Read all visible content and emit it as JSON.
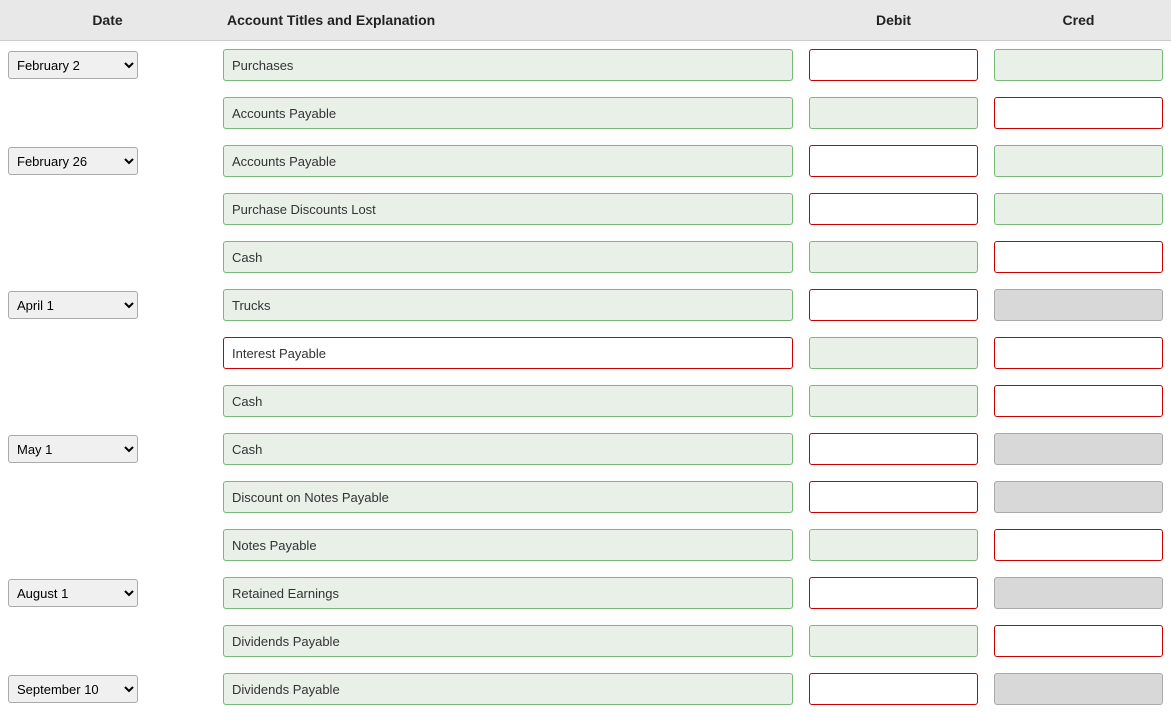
{
  "header": {
    "date_label": "Date",
    "account_label": "Account Titles and Explanation",
    "debit_label": "Debit",
    "credit_label": "Cred"
  },
  "rows": [
    {
      "date": "February 2",
      "date_options": [
        "February 2",
        "February 26",
        "April 1",
        "May 1",
        "August 1",
        "September 10"
      ],
      "account": "Purchases",
      "account_red_border": false,
      "debit_red": true,
      "credit_gray": false,
      "credit_red": false
    },
    {
      "date": "",
      "account": "Accounts Payable",
      "account_red_border": false,
      "debit_red": false,
      "credit_gray": false,
      "credit_red": true
    },
    {
      "date": "February 26",
      "date_options": [
        "February 2",
        "February 26",
        "April 1",
        "May 1",
        "August 1",
        "September 10"
      ],
      "account": "Accounts Payable",
      "account_red_border": false,
      "debit_red": true,
      "credit_gray": false,
      "credit_red": false
    },
    {
      "date": "",
      "account": "Purchase Discounts Lost",
      "account_red_border": false,
      "debit_red": true,
      "credit_gray": false,
      "credit_red": false
    },
    {
      "date": "",
      "account": "Cash",
      "account_red_border": false,
      "debit_red": false,
      "credit_gray": false,
      "credit_red": true
    },
    {
      "date": "April 1",
      "date_options": [
        "February 2",
        "February 26",
        "April 1",
        "May 1",
        "August 1",
        "September 10"
      ],
      "account": "Trucks",
      "account_red_border": false,
      "debit_red": true,
      "credit_gray": true,
      "credit_red": false
    },
    {
      "date": "",
      "account": "Interest Payable",
      "account_red_border": true,
      "debit_red": false,
      "credit_gray": false,
      "credit_red": true
    },
    {
      "date": "",
      "account": "Cash",
      "account_red_border": false,
      "debit_red": false,
      "credit_gray": false,
      "credit_red": true
    },
    {
      "date": "May 1",
      "date_options": [
        "February 2",
        "February 26",
        "April 1",
        "May 1",
        "August 1",
        "September 10"
      ],
      "account": "Cash",
      "account_red_border": false,
      "debit_red": true,
      "credit_gray": true,
      "credit_red": false
    },
    {
      "date": "",
      "account": "Discount on Notes Payable",
      "account_red_border": false,
      "debit_red": true,
      "credit_gray": true,
      "credit_red": false
    },
    {
      "date": "",
      "account": "Notes Payable",
      "account_red_border": false,
      "debit_red": false,
      "credit_gray": false,
      "credit_red": true
    },
    {
      "date": "August 1",
      "date_options": [
        "February 2",
        "February 26",
        "April 1",
        "May 1",
        "August 1",
        "September 10"
      ],
      "account": "Retained Earnings",
      "account_red_border": false,
      "debit_red": true,
      "credit_gray": true,
      "credit_red": false
    },
    {
      "date": "",
      "account": "Dividends Payable",
      "account_red_border": false,
      "debit_red": false,
      "credit_gray": false,
      "credit_red": true
    },
    {
      "date": "September 10",
      "date_options": [
        "February 2",
        "February 26",
        "April 1",
        "May 1",
        "August 1",
        "September 10"
      ],
      "account": "Dividends Payable",
      "account_red_border": false,
      "debit_red": true,
      "credit_gray": true,
      "credit_red": false
    }
  ]
}
